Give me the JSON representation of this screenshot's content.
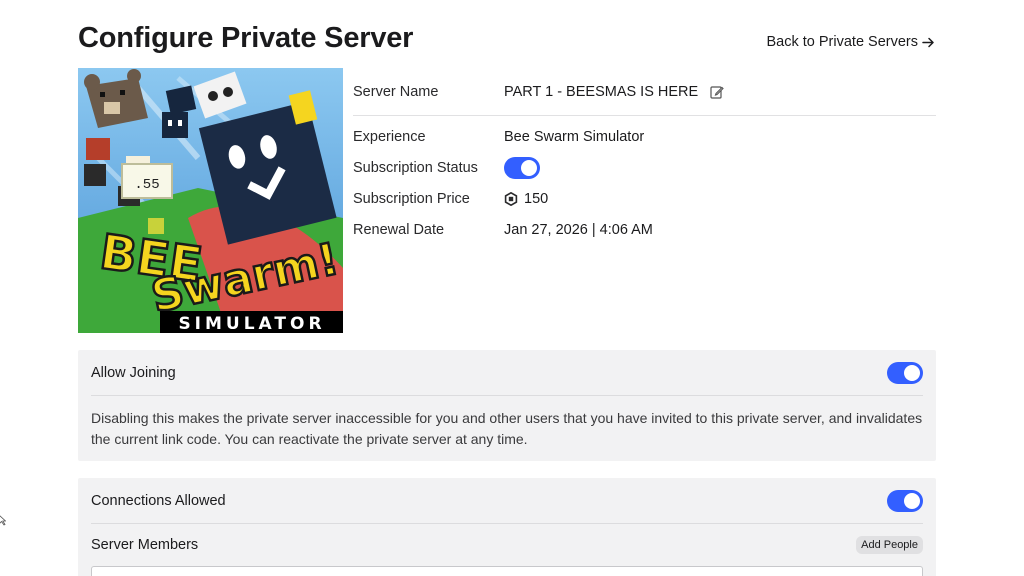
{
  "page": {
    "title": "Configure Private Server",
    "back_link_label": "Back to Private Servers",
    "back_link_icon": "arrow-right-icon"
  },
  "thumbnail": {
    "alt": "Bee Swarm Simulator",
    "logo_line1": "BEE",
    "logo_line2": "Swarm!",
    "logo_subtitle": "SIMULATOR"
  },
  "server_info": {
    "server_name_label": "Server Name",
    "server_name_value": "PART 1 - BEESMAS IS HERE",
    "experience_label": "Experience",
    "experience_value": "Bee Swarm Simulator",
    "subscription_status_label": "Subscription Status",
    "subscription_status_on": true,
    "subscription_price_label": "Subscription Price",
    "subscription_price_value": "150",
    "renewal_date_label": "Renewal Date",
    "renewal_date_value": "Jan 27, 2026 | 4:06 AM"
  },
  "allow_joining": {
    "label": "Allow Joining",
    "enabled": true,
    "description": "Disabling this makes the private server inaccessible for you and other users that you have invited to this private server, and invalidates the current link code. You can reactivate the private server at any time."
  },
  "connections": {
    "label": "Connections Allowed",
    "enabled": true,
    "members_label": "Server Members",
    "add_people_label": "Add People"
  },
  "colors": {
    "toggle_on": "#335fff",
    "card_bg": "#f2f2f3",
    "text": "#1b1b1d"
  }
}
